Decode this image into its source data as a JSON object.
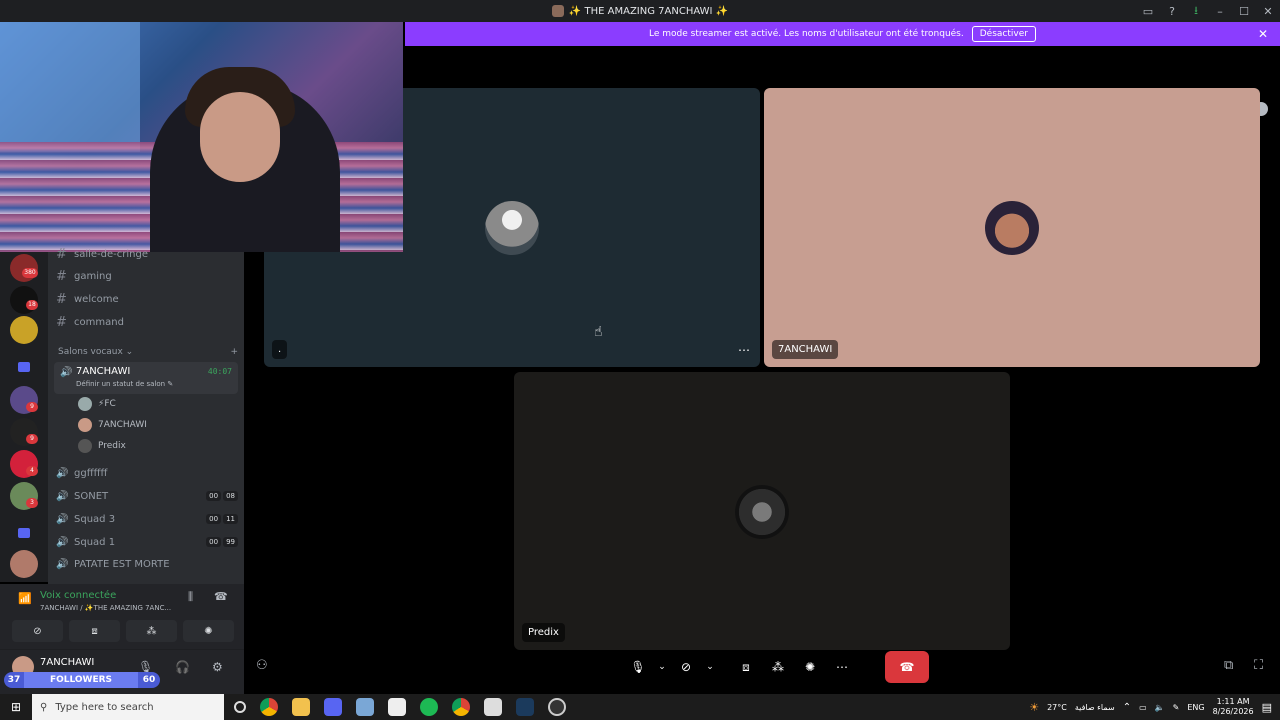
{
  "window": {
    "title": "✨ THE AMAZING 7ANCHAWI ✨",
    "controls": [
      "▭",
      "?",
      "⭳",
      "–",
      "☐",
      "✕"
    ]
  },
  "banner": {
    "text": "Le mode streamer est activé. Les noms d'utilisateur ont été tronqués.",
    "button": "Désactiver",
    "close": "✕"
  },
  "channels": {
    "text": [
      {
        "name": "salle-de-cringe"
      },
      {
        "name": "gaming"
      },
      {
        "name": "welcome"
      },
      {
        "name": "command"
      }
    ],
    "voice_section": "Salons vocaux ⌄",
    "add_symbol": "+",
    "active": {
      "name": "7ANCHAWI",
      "status": "Définir un statut de salon ✎",
      "time": "40:07",
      "members": [
        {
          "name": "⚡FC"
        },
        {
          "name": "7ANCHAWI"
        },
        {
          "name": "Predix"
        }
      ]
    },
    "voice": [
      {
        "name": "ggffffff",
        "counts": []
      },
      {
        "name": "SONET",
        "counts": [
          "00",
          "08"
        ]
      },
      {
        "name": "Squad 3",
        "counts": [
          "00",
          "11"
        ]
      },
      {
        "name": "Squad 1",
        "counts": [
          "00",
          "99"
        ]
      },
      {
        "name": "PATATE EST MORTE",
        "counts": []
      }
    ]
  },
  "guild_badges": [
    "380",
    "18",
    "9",
    "9",
    "4",
    "3"
  ],
  "voice_panel": {
    "status": "Voix connectée",
    "channel": "7ANCHAWI / ✨THE AMAZING 7ANC..."
  },
  "user_panel": {
    "name": "7ANCHAWI"
  },
  "followers": {
    "left": "37",
    "label": "FOLLOWERS",
    "right": "60"
  },
  "tiles": [
    {
      "label": "."
    },
    {
      "label": "7ANCHAWI"
    },
    {
      "label": "Predix"
    }
  ],
  "colors": {
    "accent": "#5865f2",
    "banner": "#8b3dff",
    "connected": "#3ba55d",
    "hangup": "#da373c"
  },
  "taskbar": {
    "search_placeholder": "Type here to search",
    "weather": "27°C",
    "weather_text": "سماء صافية",
    "lang": "ENG",
    "time": "1:11 AM",
    "date": "8/26/2026"
  }
}
